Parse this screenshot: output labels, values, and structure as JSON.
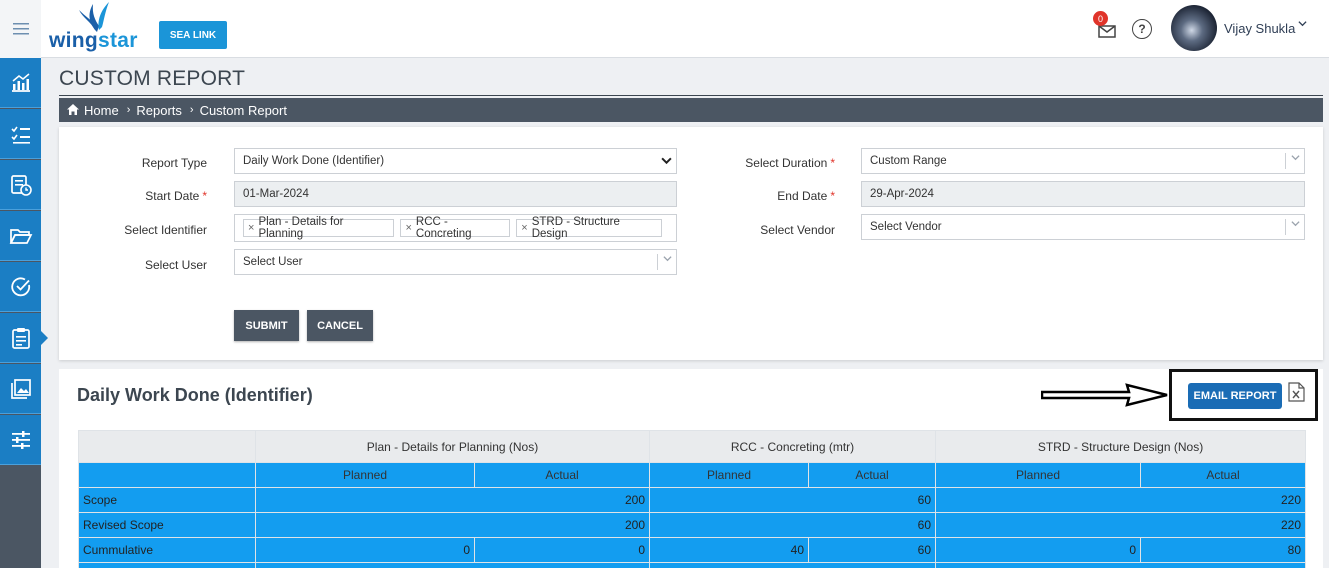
{
  "header": {
    "logo_text_a": "wing",
    "logo_text_b": "star",
    "project_button": "SEA LINK",
    "mail_badge_count": "0",
    "help_glyph": "?",
    "user_name": "Vijay Shukla",
    "icons": {
      "menu": "hamburger-icon",
      "mail": "mail-icon",
      "help": "help-icon",
      "chevron": "chevron-down-icon"
    }
  },
  "sidebar": {
    "items": [
      {
        "icon": "dashboard-chart-icon"
      },
      {
        "icon": "task-list-icon"
      },
      {
        "icon": "schedule-report-icon"
      },
      {
        "icon": "folder-icon"
      },
      {
        "icon": "approval-check-icon"
      },
      {
        "icon": "clipboard-report-icon",
        "active": true
      },
      {
        "icon": "gallery-icon"
      },
      {
        "icon": "settings-sliders-icon"
      }
    ]
  },
  "page": {
    "title": "CUSTOM REPORT",
    "breadcrumb": [
      "Home",
      "Reports",
      "Custom Report"
    ]
  },
  "form": {
    "report_type_label": "Report Type",
    "report_type_value": "Daily Work Done (Identifier)",
    "start_date_label": "Start Date",
    "start_date_value": "01-Mar-2024",
    "identifier_label": "Select Identifier",
    "identifiers": [
      "Plan - Details for Planning",
      "RCC - Concreting",
      "STRD - Structure Design"
    ],
    "user_label": "Select User",
    "user_placeholder": "Select User",
    "duration_label": "Select Duration",
    "duration_value": "Custom Range",
    "end_date_label": "End Date",
    "end_date_value": "29-Apr-2024",
    "vendor_label": "Select Vendor",
    "vendor_placeholder": "Select Vendor",
    "submit_label": "SUBMIT",
    "cancel_label": "CANCEL",
    "required_mark": "*",
    "tag_remove_glyph": "×"
  },
  "report": {
    "title": "Daily Work Done (Identifier)",
    "email_button": "EMAIL REPORT",
    "excel_icon": "excel-export-icon",
    "groups": [
      "Plan - Details for Planning (Nos)",
      "RCC - Concreting (mtr)",
      "STRD - Structure Design (Nos)"
    ],
    "sub_headers": [
      "Planned",
      "Actual",
      "Planned",
      "Actual",
      "Planned",
      "Actual"
    ],
    "rows": [
      {
        "label": "Scope",
        "cells": [
          "200",
          "60",
          "220"
        ]
      },
      {
        "label": "Revised Scope",
        "cells": [
          "200",
          "60",
          "220"
        ]
      },
      {
        "label": "Cummulative",
        "cells": [
          "0",
          "0",
          "40",
          "60",
          "0",
          "80"
        ]
      }
    ]
  },
  "colors": {
    "accent": "#1b7ec4",
    "table_blue": "#139df0",
    "dark": "#4b5663"
  }
}
